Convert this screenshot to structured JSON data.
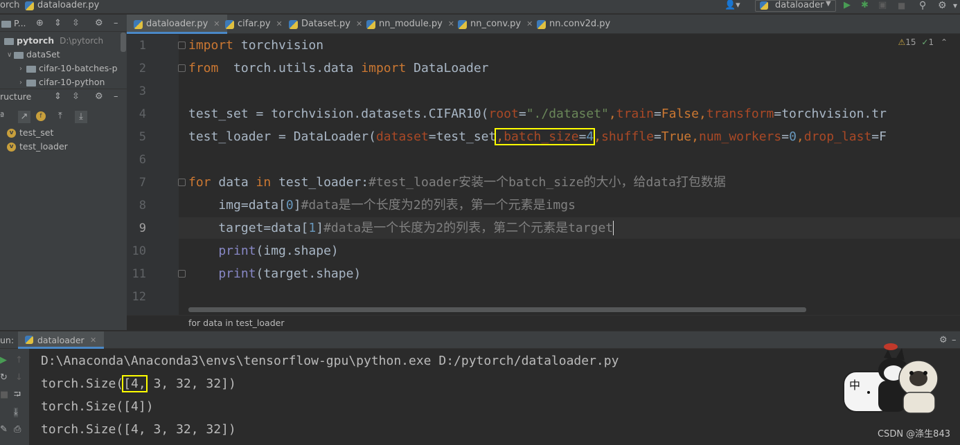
{
  "breadcrumb": {
    "project": "orch",
    "file": "dataloader.py"
  },
  "toolbar": {
    "run_config": "dataloader"
  },
  "project_panel": {
    "header": "P...",
    "root": {
      "name": "pytorch",
      "path": "D:\\pytorch"
    },
    "items": [
      "dataSet",
      "cifar-10-batches-p",
      "cifar-10-python"
    ]
  },
  "structure_panel": {
    "title": "ructure",
    "items": [
      "test_set",
      "test_loader"
    ]
  },
  "tabs": [
    "dataloader.py",
    "cifar.py",
    "Dataset.py",
    "nn_module.py",
    "nn_conv.py",
    "nn.conv2d.py"
  ],
  "inspections": {
    "warnings": "15",
    "typos": "1"
  },
  "line_numbers": [
    "1",
    "2",
    "3",
    "4",
    "5",
    "6",
    "7",
    "8",
    "9",
    "10",
    "11",
    "12"
  ],
  "code": {
    "l1": {
      "kw": "import",
      "rest": " torchvision"
    },
    "l2": {
      "kw1": "from",
      "mod": "  torch.utils.data ",
      "kw2": "import",
      "rest": " DataLoader"
    },
    "l4": {
      "a": "test_set = torchvision.datasets.CIFAR10(",
      "p1": "root",
      "eq1": "=",
      "s1": "\"./dataset\"",
      "c1": ",",
      "p2": "train",
      "eq2": "=",
      "k1": "False",
      "c2": ",",
      "p3": "transform",
      "rest": "=torchvision.tr"
    },
    "l5": {
      "a": "test_loader = DataLoader(",
      "p1": "dataset",
      "b": "=test_set",
      "c1": ",",
      "p2": "batch_size",
      "eq2": "=",
      "n1": "4",
      "c2": ",",
      "p3": "shuffle",
      "eq3": "=",
      "k1": "True",
      "c3": ",",
      "p4": "num_workers",
      "eq4": "=",
      "n2": "0",
      "c4": ",",
      "p5": "drop_last",
      "rest": "=F"
    },
    "l7": {
      "kw1": "for",
      "a": " data ",
      "kw2": "in",
      "b": " test_loader:",
      "cm": "#test_loader安装一个batch_size的大小，给data打包数据"
    },
    "l8": {
      "a": "    img=data[",
      "n": "0",
      "b": "]",
      "cm": "#data是一个长度为2的列表，第一个元素是imgs"
    },
    "l9": {
      "a": "    target=data[",
      "n": "1",
      "b": "]",
      "cm": "#data是一个长度为2的列表，第二个元素是target"
    },
    "l10": {
      "bi": "    print",
      "rest": "(img.shape)"
    },
    "l11": {
      "bi": "    print",
      "rest": "(target.shape)"
    }
  },
  "status_hint": "for data in test_loader",
  "run_tab": {
    "label": "un:",
    "config": "dataloader"
  },
  "output": [
    "D:\\Anaconda\\Anaconda3\\envs\\tensorflow-gpu\\python.exe D:/pytorch/dataloader.py",
    "torch.Size([4, 3, 32, 32])",
    "torch.Size([4])",
    "torch.Size([4, 3, 32, 32])"
  ],
  "output_l2": {
    "a": "torch.Size(",
    "hl": "[4,",
    "b": " 3, 32, 32])"
  },
  "sticker_text": "中",
  "watermark": "CSDN @涤生843",
  "colors": {
    "highlight_box": "#ffff00",
    "keyword": "#cc7832",
    "string": "#6a8759",
    "number": "#6897bb",
    "comment": "#808080",
    "param": "#aa4926"
  }
}
